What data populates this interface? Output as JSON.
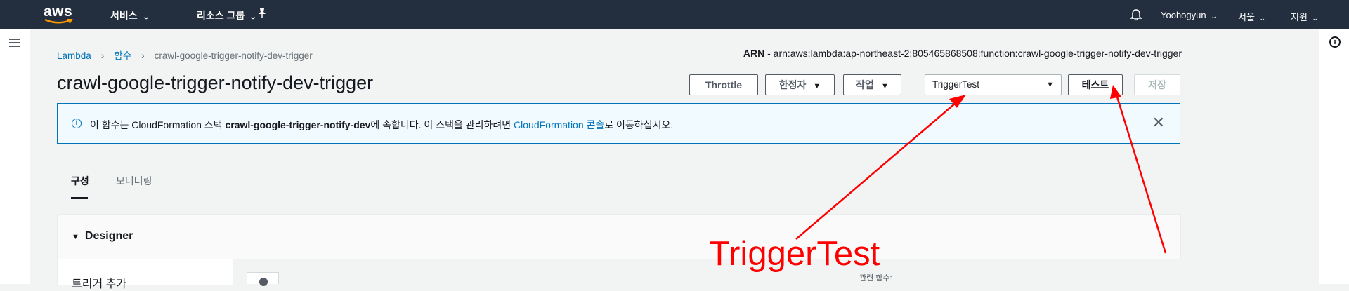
{
  "topnav": {
    "logo": "aws",
    "services": "서비스",
    "resource_groups": "리소스 그룹",
    "pin_icon": "pin-icon",
    "bell_icon": "bell-icon",
    "user": "Yoohogyun",
    "region": "서울",
    "support": "지원"
  },
  "breadcrumb": {
    "root": "Lambda",
    "functions": "함수",
    "current": "crawl-google-trigger-notify-dev-trigger"
  },
  "arn": {
    "label": "ARN",
    "value": " - arn:aws:lambda:ap-northeast-2:805465868508:function:crawl-google-trigger-notify-dev-trigger"
  },
  "page_title": "crawl-google-trigger-notify-dev-trigger",
  "actions": {
    "throttle": "Throttle",
    "qualifier": "한정자",
    "actions": "작업",
    "test_event": "TriggerTest",
    "test": "테스트",
    "save": "저장"
  },
  "banner": {
    "text1": "이 함수는 CloudFormation 스택 ",
    "stack": "crawl-google-trigger-notify-dev",
    "text2": "에 속합니다. 이 스택을 관리하려면 ",
    "link": "CloudFormation 콘솔",
    "text3": "로 이동하십시오."
  },
  "tabs": {
    "config": "구성",
    "monitoring": "모니터링"
  },
  "designer": {
    "title": "Designer",
    "add_trigger": "트리거 추가",
    "related_functions": "관련 함수:"
  },
  "annotation": {
    "text": "TriggerTest",
    "color": "#ff0000"
  },
  "colors": {
    "nav_bg": "#232f3e",
    "link": "#0073bb",
    "banner_bg": "#f1faff"
  }
}
